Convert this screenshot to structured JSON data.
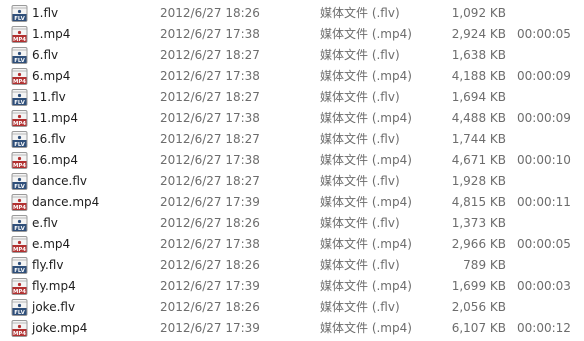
{
  "files": [
    {
      "name": "1.flv",
      "date": "2012/6/27 18:26",
      "type": "媒体文件 (.flv)",
      "size": "1,092 KB",
      "duration": "",
      "icon": "flv-file-icon"
    },
    {
      "name": "1.mp4",
      "date": "2012/6/27 17:38",
      "type": "媒体文件 (.mp4)",
      "size": "2,924 KB",
      "duration": "00:00:05",
      "icon": "mp4-file-icon"
    },
    {
      "name": "6.flv",
      "date": "2012/6/27 18:27",
      "type": "媒体文件 (.flv)",
      "size": "1,638 KB",
      "duration": "",
      "icon": "flv-file-icon"
    },
    {
      "name": "6.mp4",
      "date": "2012/6/27 17:38",
      "type": "媒体文件 (.mp4)",
      "size": "4,188 KB",
      "duration": "00:00:09",
      "icon": "mp4-file-icon"
    },
    {
      "name": "11.flv",
      "date": "2012/6/27 18:27",
      "type": "媒体文件 (.flv)",
      "size": "1,694 KB",
      "duration": "",
      "icon": "flv-file-icon"
    },
    {
      "name": "11.mp4",
      "date": "2012/6/27 17:38",
      "type": "媒体文件 (.mp4)",
      "size": "4,488 KB",
      "duration": "00:00:09",
      "icon": "mp4-file-icon"
    },
    {
      "name": "16.flv",
      "date": "2012/6/27 18:27",
      "type": "媒体文件 (.flv)",
      "size": "1,744 KB",
      "duration": "",
      "icon": "flv-file-icon"
    },
    {
      "name": "16.mp4",
      "date": "2012/6/27 17:38",
      "type": "媒体文件 (.mp4)",
      "size": "4,671 KB",
      "duration": "00:00:10",
      "icon": "mp4-file-icon"
    },
    {
      "name": "dance.flv",
      "date": "2012/6/27 18:27",
      "type": "媒体文件 (.flv)",
      "size": "1,928 KB",
      "duration": "",
      "icon": "flv-file-icon"
    },
    {
      "name": "dance.mp4",
      "date": "2012/6/27 17:39",
      "type": "媒体文件 (.mp4)",
      "size": "4,815 KB",
      "duration": "00:00:11",
      "icon": "mp4-file-icon"
    },
    {
      "name": "e.flv",
      "date": "2012/6/27 18:26",
      "type": "媒体文件 (.flv)",
      "size": "1,373 KB",
      "duration": "",
      "icon": "flv-file-icon"
    },
    {
      "name": "e.mp4",
      "date": "2012/6/27 17:38",
      "type": "媒体文件 (.mp4)",
      "size": "2,966 KB",
      "duration": "00:00:05",
      "icon": "mp4-file-icon"
    },
    {
      "name": "fly.flv",
      "date": "2012/6/27 18:26",
      "type": "媒体文件 (.flv)",
      "size": "789 KB",
      "duration": "",
      "icon": "flv-file-icon"
    },
    {
      "name": "fly.mp4",
      "date": "2012/6/27 17:39",
      "type": "媒体文件 (.mp4)",
      "size": "1,699 KB",
      "duration": "00:00:03",
      "icon": "mp4-file-icon"
    },
    {
      "name": "joke.flv",
      "date": "2012/6/27 18:26",
      "type": "媒体文件 (.flv)",
      "size": "2,056 KB",
      "duration": "",
      "icon": "flv-file-icon"
    },
    {
      "name": "joke.mp4",
      "date": "2012/6/27 17:39",
      "type": "媒体文件 (.mp4)",
      "size": "6,107 KB",
      "duration": "00:00:12",
      "icon": "mp4-file-icon"
    }
  ],
  "icon_text": {
    "flv": "FLV",
    "mp4": "MP4"
  },
  "colors": {
    "name": "#1e1e1e",
    "meta": "#6d6d6d",
    "flv_icon": "#2f4f7a",
    "mp4_icon": "#b23030"
  }
}
